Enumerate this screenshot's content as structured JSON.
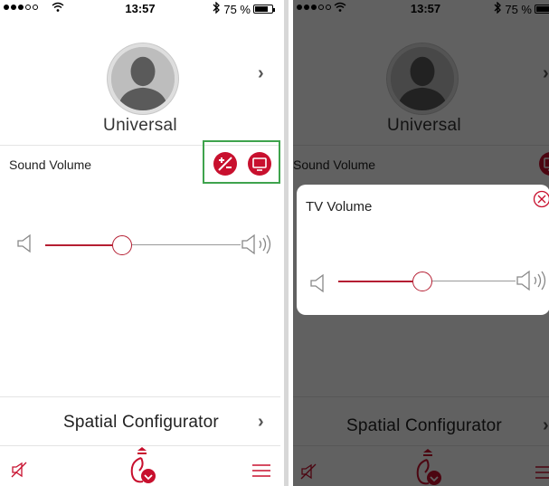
{
  "status": {
    "time": "13:57",
    "battery": "75 %"
  },
  "profile": {
    "name": "Universal"
  },
  "sound": {
    "label": "Sound Volume"
  },
  "bottom": {
    "title": "Spatial Configurator"
  },
  "dialog": {
    "title": "TV Volume"
  },
  "sliders": {
    "main_level": 0.38,
    "tv_level": 0.47
  },
  "icons": {
    "signal": "signal-dots-icon",
    "wifi": "wifi-icon",
    "bluetooth": "bluetooth-icon",
    "battery": "battery-icon",
    "avatar": "person-silhouette-icon",
    "chevron": "chevron-right-icon",
    "volume_adjust": "volume-plus-minus-icon",
    "tv": "tv-icon",
    "speaker_low": "speaker-low-icon",
    "speaker_high": "speaker-high-icon",
    "mute": "mute-icon",
    "center": "hearing-aid-icon",
    "menu": "menu-icon",
    "close": "close-icon"
  },
  "colors": {
    "accent": "#c8102e",
    "highlight": "#3fa34d"
  }
}
